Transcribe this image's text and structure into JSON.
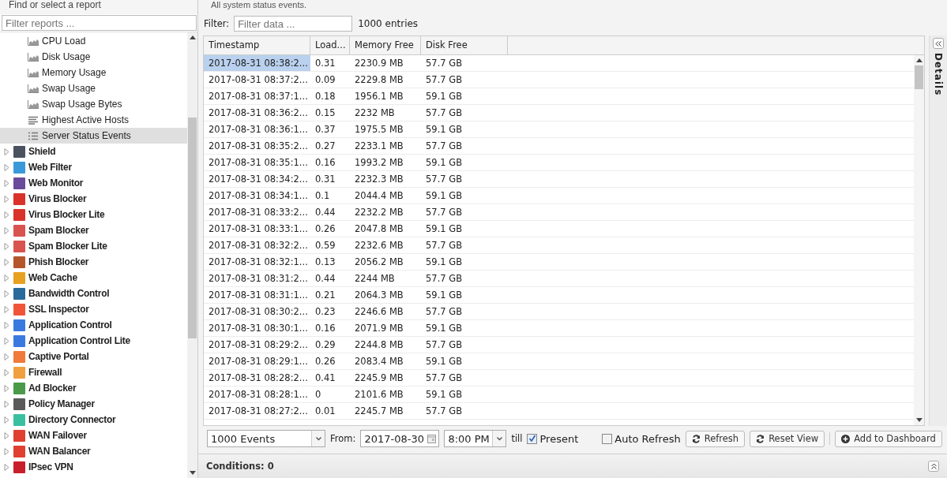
{
  "sidebar": {
    "title": "Find or select a report",
    "filter": {
      "placeholder": "Filter reports ..."
    },
    "reports": [
      {
        "label": "CPU Load",
        "kind": "chart",
        "selected": false
      },
      {
        "label": "Disk Usage",
        "kind": "chart",
        "selected": false
      },
      {
        "label": "Memory Usage",
        "kind": "chart",
        "selected": false
      },
      {
        "label": "Swap Usage",
        "kind": "chart",
        "selected": false
      },
      {
        "label": "Swap Usage Bytes",
        "kind": "chart",
        "selected": false
      },
      {
        "label": "Highest Active Hosts",
        "kind": "bars",
        "selected": false
      },
      {
        "label": "Server Status Events",
        "kind": "list",
        "selected": true
      }
    ],
    "apps": [
      {
        "label": "Shield",
        "color": "#4a5260",
        "expanded": false
      },
      {
        "label": "Web Filter",
        "color": "#3a9ad9",
        "expanded": false
      },
      {
        "label": "Web Monitor",
        "color": "#6a4a9a",
        "expanded": false
      },
      {
        "label": "Virus Blocker",
        "color": "#d9322a",
        "expanded": false
      },
      {
        "label": "Virus Blocker Lite",
        "color": "#d9322a",
        "expanded": false
      },
      {
        "label": "Spam Blocker",
        "color": "#d9534f",
        "expanded": false
      },
      {
        "label": "Spam Blocker Lite",
        "color": "#d9534f",
        "expanded": false
      },
      {
        "label": "Phish Blocker",
        "color": "#b5552a",
        "expanded": false
      },
      {
        "label": "Web Cache",
        "color": "#e8a020",
        "expanded": false
      },
      {
        "label": "Bandwidth Control",
        "color": "#2a6a9a",
        "expanded": false
      },
      {
        "label": "SSL Inspector",
        "color": "#f0553a",
        "expanded": false
      },
      {
        "label": "Application Control",
        "color": "#3a7ae0",
        "expanded": false
      },
      {
        "label": "Application Control Lite",
        "color": "#3a7ae0",
        "expanded": false
      },
      {
        "label": "Captive Portal",
        "color": "#f07a3a",
        "expanded": false
      },
      {
        "label": "Firewall",
        "color": "#f0a040",
        "expanded": false
      },
      {
        "label": "Ad Blocker",
        "color": "#4a9a4a",
        "expanded": false
      },
      {
        "label": "Policy Manager",
        "color": "#5a5a5a",
        "expanded": false
      },
      {
        "label": "Directory Connector",
        "color": "#3ac0a0",
        "expanded": false
      },
      {
        "label": "WAN Failover",
        "color": "#e04030",
        "expanded": false
      },
      {
        "label": "WAN Balancer",
        "color": "#e04030",
        "expanded": false
      },
      {
        "label": "IPsec VPN",
        "color": "#c8202a",
        "expanded": false
      }
    ]
  },
  "description": "All system status events.",
  "filter": {
    "label": "Filter:",
    "placeholder": "Filter data ...",
    "count": "1000 entries"
  },
  "table": {
    "columns": [
      "Timestamp",
      "Load...",
      "Memory Free",
      "Disk Free"
    ],
    "rows": [
      {
        "cells": [
          "2017-08-31 08:38:2...",
          "0.31",
          "2230.9 MB",
          "57.7 GB"
        ],
        "selected": true
      },
      {
        "cells": [
          "2017-08-31 08:37:2...",
          "0.09",
          "2229.8 MB",
          "57.7 GB"
        ],
        "selected": false
      },
      {
        "cells": [
          "2017-08-31 08:37:1...",
          "0.18",
          "1956.1 MB",
          "59.1 GB"
        ],
        "selected": false
      },
      {
        "cells": [
          "2017-08-31 08:36:2...",
          "0.15",
          "2232 MB",
          "57.7 GB"
        ],
        "selected": false
      },
      {
        "cells": [
          "2017-08-31 08:36:1...",
          "0.37",
          "1975.5 MB",
          "59.1 GB"
        ],
        "selected": false
      },
      {
        "cells": [
          "2017-08-31 08:35:2...",
          "0.27",
          "2233.1 MB",
          "57.7 GB"
        ],
        "selected": false
      },
      {
        "cells": [
          "2017-08-31 08:35:1...",
          "0.16",
          "1993.2 MB",
          "59.1 GB"
        ],
        "selected": false
      },
      {
        "cells": [
          "2017-08-31 08:34:2...",
          "0.31",
          "2232.3 MB",
          "57.7 GB"
        ],
        "selected": false
      },
      {
        "cells": [
          "2017-08-31 08:34:1...",
          "0.1",
          "2044.4 MB",
          "59.1 GB"
        ],
        "selected": false
      },
      {
        "cells": [
          "2017-08-31 08:33:2...",
          "0.44",
          "2232.2 MB",
          "57.7 GB"
        ],
        "selected": false
      },
      {
        "cells": [
          "2017-08-31 08:33:1...",
          "0.26",
          "2047.8 MB",
          "59.1 GB"
        ],
        "selected": false
      },
      {
        "cells": [
          "2017-08-31 08:32:2...",
          "0.59",
          "2232.6 MB",
          "57.7 GB"
        ],
        "selected": false
      },
      {
        "cells": [
          "2017-08-31 08:32:1...",
          "0.13",
          "2056.2 MB",
          "59.1 GB"
        ],
        "selected": false
      },
      {
        "cells": [
          "2017-08-31 08:31:2...",
          "0.44",
          "2244 MB",
          "57.7 GB"
        ],
        "selected": false
      },
      {
        "cells": [
          "2017-08-31 08:31:1...",
          "0.21",
          "2064.3 MB",
          "59.1 GB"
        ],
        "selected": false
      },
      {
        "cells": [
          "2017-08-31 08:30:2...",
          "0.23",
          "2246.6 MB",
          "57.7 GB"
        ],
        "selected": false
      },
      {
        "cells": [
          "2017-08-31 08:30:1...",
          "0.16",
          "2071.9 MB",
          "59.1 GB"
        ],
        "selected": false
      },
      {
        "cells": [
          "2017-08-31 08:29:2...",
          "0.29",
          "2244.8 MB",
          "57.7 GB"
        ],
        "selected": false
      },
      {
        "cells": [
          "2017-08-31 08:29:1...",
          "0.26",
          "2083.4 MB",
          "59.1 GB"
        ],
        "selected": false
      },
      {
        "cells": [
          "2017-08-31 08:28:2...",
          "0.41",
          "2245.9 MB",
          "57.7 GB"
        ],
        "selected": false
      },
      {
        "cells": [
          "2017-08-31 08:28:1...",
          "0",
          "2101.6 MB",
          "59.1 GB"
        ],
        "selected": false
      },
      {
        "cells": [
          "2017-08-31 08:27:2...",
          "0.01",
          "2245.7 MB",
          "57.7 GB"
        ],
        "selected": false
      }
    ]
  },
  "toolbar": {
    "limit": "1000 Events",
    "from_label": "From:",
    "date": "2017-08-30",
    "time": "8:00 PM",
    "till_label": "till",
    "present": {
      "label": "Present",
      "checked": true
    },
    "auto_refresh": {
      "label": "Auto Refresh",
      "checked": false
    },
    "buttons": [
      {
        "label": "Refresh",
        "kind": "refresh"
      },
      {
        "label": "Reset View",
        "kind": "refresh"
      },
      {
        "label": "Add to Dashboard",
        "kind": "add"
      }
    ]
  },
  "conditions": "Conditions: 0",
  "details": {
    "title": "Details"
  }
}
